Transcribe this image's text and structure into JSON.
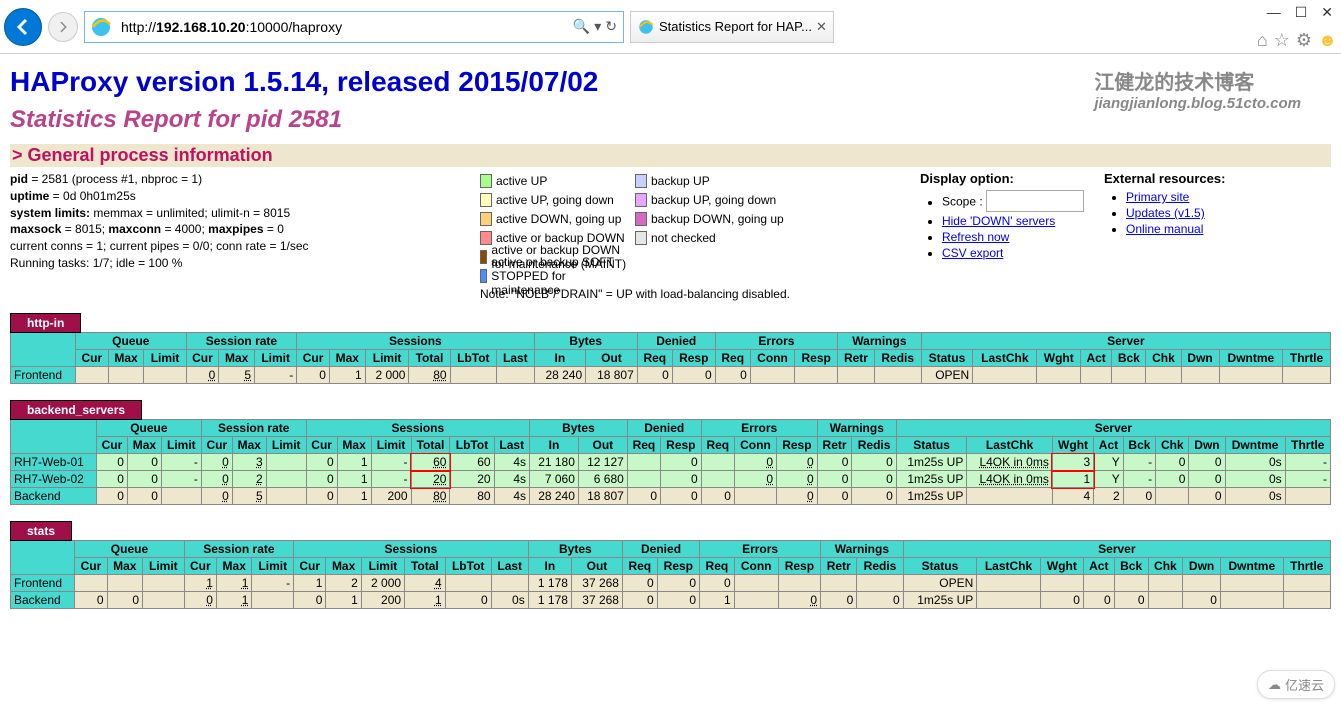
{
  "browser": {
    "url_prefix": "http://",
    "url_ip": "192.168.10.20",
    "url_suffix": ":10000/haproxy",
    "tab_title": "Statistics Report for HAP..."
  },
  "watermark": {
    "cn": "江健龙的技术博客",
    "en": "jiangjianlong.blog.51cto.com"
  },
  "page_title": "HAProxy version 1.5.14, released 2015/07/02",
  "subtitle": "Statistics Report for pid 2581",
  "section_header": "> General process information",
  "info": {
    "pid_label": "pid",
    "pid_val": " = 2581 (process #1, nbproc = 1)",
    "uptime_label": "uptime",
    "uptime_val": " = 0d 0h01m25s",
    "syslimits_label": "system limits:",
    "syslimits_val": " memmax = unlimited; ulimit-n = 8015",
    "maxsock_label": "maxsock",
    "maxsock_val": " = 8015; ",
    "maxconn_label": "maxconn",
    "maxconn_val": " = 4000; ",
    "maxpipes_label": "maxpipes",
    "maxpipes_val": " = 0",
    "conns": "current conns = 1; current pipes = 0/0; conn rate = 1/sec",
    "tasks": "Running tasks: 1/7; idle = 100 %"
  },
  "legend": {
    "active_up": "active UP",
    "backup_up": "backup UP",
    "active_up_gd": "active UP, going down",
    "backup_up_gd": "backup UP, going down",
    "active_down_gu": "active DOWN, going up",
    "backup_down_gu": "backup DOWN, going up",
    "active_backup_down": "active or backup DOWN",
    "not_checked": "not checked",
    "maint": "active or backup DOWN for maintenance (MAINT)",
    "soft": "active or backup SOFT STOPPED for maintenance",
    "note": "Note: \"NOLB\"/\"DRAIN\" = UP with load-balancing disabled."
  },
  "display_option": {
    "title": "Display option:",
    "scope": "Scope : ",
    "hide_down": "Hide 'DOWN' servers",
    "refresh": "Refresh now",
    "csv": "CSV export"
  },
  "external": {
    "title": "External resources:",
    "primary": "Primary site",
    "updates": "Updates (v1.5)",
    "manual": "Online manual"
  },
  "headers": {
    "groups": [
      "",
      "Queue",
      "Session rate",
      "Sessions",
      "Bytes",
      "Denied",
      "Errors",
      "Warnings",
      "Server"
    ],
    "cols": [
      "",
      "Cur",
      "Max",
      "Limit",
      "Cur",
      "Max",
      "Limit",
      "Cur",
      "Max",
      "Limit",
      "Total",
      "LbTot",
      "Last",
      "In",
      "Out",
      "Req",
      "Resp",
      "Req",
      "Conn",
      "Resp",
      "Retr",
      "Redis",
      "Status",
      "LastChk",
      "Wght",
      "Act",
      "Bck",
      "Chk",
      "Dwn",
      "Dwntme",
      "Thrtle"
    ]
  },
  "proxies": {
    "http_in": {
      "name": "http-in",
      "frontend": [
        "Frontend",
        "",
        "",
        "",
        "0",
        "5",
        "-",
        "0",
        "1",
        "2 000",
        "80",
        "",
        "",
        "28 240",
        "18 807",
        "0",
        "0",
        "0",
        "",
        "",
        "",
        "",
        "OPEN",
        "",
        "",
        "",
        "",
        "",
        "",
        "",
        ""
      ]
    },
    "backend_servers": {
      "name": "backend_servers",
      "rows": [
        [
          "RH7-Web-01",
          "0",
          "0",
          "-",
          "0",
          "3",
          "",
          "0",
          "1",
          "-",
          "60",
          "60",
          "4s",
          "21 180",
          "12 127",
          "",
          "0",
          "",
          "0",
          "0",
          "0",
          "0",
          "1m25s UP",
          "L4OK in 0ms",
          "3",
          "Y",
          "-",
          "0",
          "0",
          "0s",
          "-"
        ],
        [
          "RH7-Web-02",
          "0",
          "0",
          "-",
          "0",
          "2",
          "",
          "0",
          "1",
          "-",
          "20",
          "20",
          "4s",
          "7 060",
          "6 680",
          "",
          "0",
          "",
          "0",
          "0",
          "0",
          "0",
          "1m25s UP",
          "L4OK in 0ms",
          "1",
          "Y",
          "-",
          "0",
          "0",
          "0s",
          "-"
        ]
      ],
      "backend": [
        "Backend",
        "0",
        "0",
        "",
        "0",
        "5",
        "",
        "0",
        "1",
        "200",
        "80",
        "80",
        "4s",
        "28 240",
        "18 807",
        "0",
        "0",
        "0",
        "",
        "0",
        "0",
        "0",
        "1m25s UP",
        "",
        "4",
        "2",
        "0",
        "",
        "0",
        "0s",
        ""
      ]
    },
    "stats": {
      "name": "stats",
      "frontend": [
        "Frontend",
        "",
        "",
        "",
        "1",
        "1",
        "-",
        "1",
        "2",
        "2 000",
        "4",
        "",
        "",
        "1 178",
        "37 268",
        "0",
        "0",
        "0",
        "",
        "",
        "",
        "",
        "OPEN",
        "",
        "",
        "",
        "",
        "",
        "",
        "",
        ""
      ],
      "backend": [
        "Backend",
        "0",
        "0",
        "",
        "0",
        "1",
        "",
        "0",
        "1",
        "200",
        "1",
        "0",
        "0s",
        "1 178",
        "37 268",
        "0",
        "0",
        "1",
        "",
        "0",
        "0",
        "0",
        "1m25s UP",
        "",
        "0",
        "0",
        "0",
        "",
        "0",
        "",
        ""
      ]
    }
  },
  "cloud_badge": "亿速云"
}
